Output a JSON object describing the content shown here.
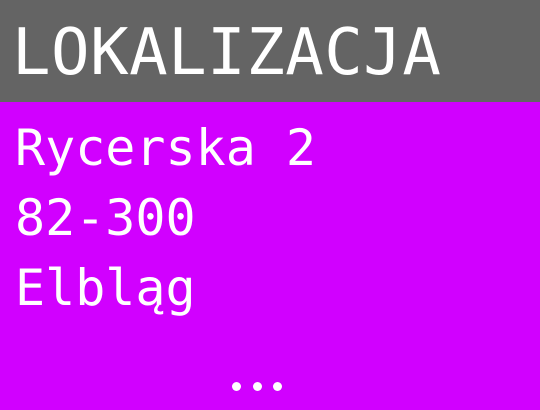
{
  "header": {
    "title": "LOKALIZACJA"
  },
  "address": {
    "street": "Rycerska 2",
    "postal_code": "82-300",
    "city": "Elbląg"
  },
  "more_indicator": {
    "icon": "ellipsis-icon"
  },
  "colors": {
    "header_background": "#646464",
    "body_background": "#d100ff",
    "text": "#ffffff"
  }
}
